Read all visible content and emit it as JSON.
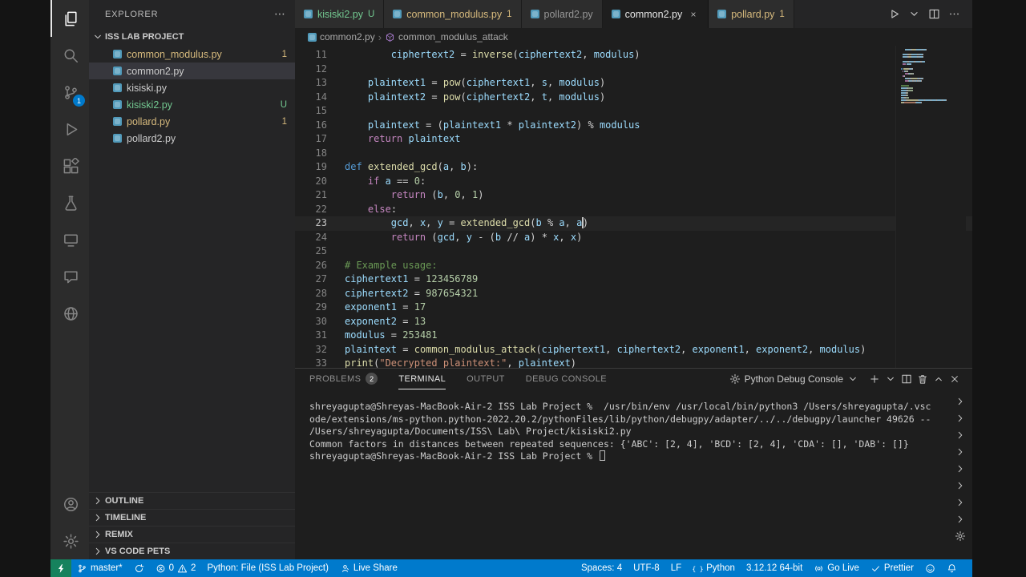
{
  "activity_bar": {
    "items": [
      {
        "name": "explorer",
        "icon": "files",
        "active": true
      },
      {
        "name": "search",
        "icon": "search"
      },
      {
        "name": "source-control",
        "icon": "scm",
        "badge": "1"
      },
      {
        "name": "run-debug",
        "icon": "debug"
      },
      {
        "name": "extensions",
        "icon": "extensions"
      },
      {
        "name": "testing",
        "icon": "flask"
      },
      {
        "name": "remote-explorer",
        "icon": "remote"
      },
      {
        "name": "comments",
        "icon": "comment"
      },
      {
        "name": "browser-preview",
        "icon": "globe"
      }
    ],
    "bottom": [
      {
        "name": "account",
        "icon": "account"
      },
      {
        "name": "settings",
        "icon": "gear"
      }
    ]
  },
  "sidebar": {
    "title": "EXPLORER",
    "more": "⋯",
    "section": "ISS LAB PROJECT",
    "files": [
      {
        "name": "common_modulus.py",
        "badge": "1",
        "color": "warning"
      },
      {
        "name": "common2.py",
        "selected": true
      },
      {
        "name": "kisiski.py"
      },
      {
        "name": "kisiski2.py",
        "badge": "U",
        "color": "added"
      },
      {
        "name": "pollard.py",
        "badge": "1",
        "color": "warning"
      },
      {
        "name": "pollard2.py"
      }
    ],
    "bottom_sections": [
      "OUTLINE",
      "TIMELINE",
      "REMIX",
      "VS CODE PETS"
    ]
  },
  "tabs": [
    {
      "label": "kisiski2.py",
      "badge": "U",
      "color": "added"
    },
    {
      "label": "common_modulus.py",
      "badge": "1",
      "color": "warning"
    },
    {
      "label": "pollard2.py"
    },
    {
      "label": "common2.py",
      "active": true
    },
    {
      "label": "pollard.py",
      "badge": "1",
      "color": "warning"
    }
  ],
  "editor_actions": [
    {
      "name": "run-python-file",
      "icon": "play"
    },
    {
      "name": "run-dropdown",
      "icon": "chevron-down"
    },
    {
      "name": "split-editor",
      "icon": "split"
    },
    {
      "name": "editor-more-actions",
      "icon": "ellipsis"
    }
  ],
  "breadcrumb": {
    "file": "common2.py",
    "symbol": "common_modulus_attack"
  },
  "editor": {
    "lines": [
      {
        "n": "11",
        "t": [
          [
            "        ",
            "p"
          ],
          [
            "ciphertext2",
            "v"
          ],
          [
            " = ",
            "p"
          ],
          [
            "inverse",
            "f"
          ],
          [
            "(",
            "p"
          ],
          [
            "ciphertext2",
            "v"
          ],
          [
            ", ",
            "p"
          ],
          [
            "modulus",
            "v"
          ],
          [
            ")",
            "p"
          ]
        ]
      },
      {
        "n": "12",
        "t": []
      },
      {
        "n": "13",
        "t": [
          [
            "    ",
            "p"
          ],
          [
            "plaintext1",
            "v"
          ],
          [
            " = ",
            "p"
          ],
          [
            "pow",
            "f"
          ],
          [
            "(",
            "p"
          ],
          [
            "ciphertext1",
            "v"
          ],
          [
            ", ",
            "p"
          ],
          [
            "s",
            "v"
          ],
          [
            ", ",
            "p"
          ],
          [
            "modulus",
            "v"
          ],
          [
            ")",
            "p"
          ]
        ]
      },
      {
        "n": "14",
        "t": [
          [
            "    ",
            "p"
          ],
          [
            "plaintext2",
            "v"
          ],
          [
            " = ",
            "p"
          ],
          [
            "pow",
            "f"
          ],
          [
            "(",
            "p"
          ],
          [
            "ciphertext2",
            "v"
          ],
          [
            ", ",
            "p"
          ],
          [
            "t",
            "v"
          ],
          [
            ", ",
            "p"
          ],
          [
            "modulus",
            "v"
          ],
          [
            ")",
            "p"
          ]
        ]
      },
      {
        "n": "15",
        "t": []
      },
      {
        "n": "16",
        "t": [
          [
            "    ",
            "p"
          ],
          [
            "plaintext",
            "v"
          ],
          [
            " = (",
            "p"
          ],
          [
            "plaintext1",
            "v"
          ],
          [
            " * ",
            "p"
          ],
          [
            "plaintext2",
            "v"
          ],
          [
            ") % ",
            "p"
          ],
          [
            "modulus",
            "v"
          ]
        ]
      },
      {
        "n": "17",
        "t": [
          [
            "    ",
            "p"
          ],
          [
            "return",
            "k"
          ],
          [
            " ",
            "p"
          ],
          [
            "plaintext",
            "v"
          ]
        ]
      },
      {
        "n": "18",
        "t": []
      },
      {
        "n": "19",
        "t": [
          [
            "def",
            "d"
          ],
          [
            " ",
            "p"
          ],
          [
            "extended_gcd",
            "f"
          ],
          [
            "(",
            "p"
          ],
          [
            "a",
            "v"
          ],
          [
            ", ",
            "p"
          ],
          [
            "b",
            "v"
          ],
          [
            "):",
            "p"
          ]
        ]
      },
      {
        "n": "20",
        "t": [
          [
            "    ",
            "p"
          ],
          [
            "if",
            "k"
          ],
          [
            " ",
            "p"
          ],
          [
            "a",
            "v"
          ],
          [
            " == ",
            "p"
          ],
          [
            "0",
            "n"
          ],
          [
            ":",
            "p"
          ]
        ]
      },
      {
        "n": "21",
        "t": [
          [
            "        ",
            "p"
          ],
          [
            "return",
            "k"
          ],
          [
            " (",
            "p"
          ],
          [
            "b",
            "v"
          ],
          [
            ", ",
            "p"
          ],
          [
            "0",
            "n"
          ],
          [
            ", ",
            "p"
          ],
          [
            "1",
            "n"
          ],
          [
            ")",
            "p"
          ]
        ]
      },
      {
        "n": "22",
        "t": [
          [
            "    ",
            "p"
          ],
          [
            "else",
            "k"
          ],
          [
            ":",
            "p"
          ]
        ]
      },
      {
        "n": "23",
        "cur": true,
        "t": [
          [
            "        ",
            "p"
          ],
          [
            "gcd",
            "v"
          ],
          [
            ", ",
            "p"
          ],
          [
            "x",
            "v"
          ],
          [
            ", ",
            "p"
          ],
          [
            "y",
            "v"
          ],
          [
            " = ",
            "p"
          ],
          [
            "extended_gcd",
            "f"
          ],
          [
            "(",
            "p"
          ],
          [
            "b",
            "v"
          ],
          [
            " % ",
            "p"
          ],
          [
            "a",
            "v"
          ],
          [
            ", ",
            "p"
          ],
          [
            "a",
            "v"
          ],
          [
            "",
            "caret"
          ],
          [
            ")",
            "p"
          ]
        ]
      },
      {
        "n": "24",
        "t": [
          [
            "        ",
            "p"
          ],
          [
            "return",
            "k"
          ],
          [
            " (",
            "p"
          ],
          [
            "gcd",
            "v"
          ],
          [
            ", ",
            "p"
          ],
          [
            "y",
            "v"
          ],
          [
            " - (",
            "p"
          ],
          [
            "b",
            "v"
          ],
          [
            " // ",
            "p"
          ],
          [
            "a",
            "v"
          ],
          [
            ") * ",
            "p"
          ],
          [
            "x",
            "v"
          ],
          [
            ", ",
            "p"
          ],
          [
            "x",
            "v"
          ],
          [
            ")",
            "p"
          ]
        ]
      },
      {
        "n": "25",
        "t": []
      },
      {
        "n": "26",
        "t": [
          [
            "# Example usage:",
            "c"
          ]
        ]
      },
      {
        "n": "27",
        "t": [
          [
            "ciphertext1",
            "v"
          ],
          [
            " = ",
            "p"
          ],
          [
            "123456789",
            "n"
          ]
        ]
      },
      {
        "n": "28",
        "t": [
          [
            "ciphertext2",
            "v"
          ],
          [
            " = ",
            "p"
          ],
          [
            "987654321",
            "n"
          ]
        ]
      },
      {
        "n": "29",
        "t": [
          [
            "exponent1",
            "v"
          ],
          [
            " = ",
            "p"
          ],
          [
            "17",
            "n"
          ]
        ]
      },
      {
        "n": "30",
        "t": [
          [
            "exponent2",
            "v"
          ],
          [
            " = ",
            "p"
          ],
          [
            "13",
            "n"
          ]
        ]
      },
      {
        "n": "31",
        "t": [
          [
            "modulus",
            "v"
          ],
          [
            " = ",
            "p"
          ],
          [
            "253481",
            "n"
          ]
        ]
      },
      {
        "n": "32",
        "t": [
          [
            "plaintext",
            "v"
          ],
          [
            " = ",
            "p"
          ],
          [
            "common_modulus_attack",
            "f"
          ],
          [
            "(",
            "p"
          ],
          [
            "ciphertext1",
            "v"
          ],
          [
            ", ",
            "p"
          ],
          [
            "ciphertext2",
            "v"
          ],
          [
            ", ",
            "p"
          ],
          [
            "exponent1",
            "v"
          ],
          [
            ", ",
            "p"
          ],
          [
            "exponent2",
            "v"
          ],
          [
            ", ",
            "p"
          ],
          [
            "modulus",
            "v"
          ],
          [
            ")",
            "p"
          ]
        ]
      },
      {
        "n": "33",
        "t": [
          [
            "print",
            "f"
          ],
          [
            "(",
            "p"
          ],
          [
            "\"Decrypted plaintext:\"",
            "s"
          ],
          [
            ", ",
            "p"
          ],
          [
            "plaintext",
            "v"
          ],
          [
            ")",
            "p"
          ]
        ]
      }
    ]
  },
  "panel": {
    "tabs": [
      {
        "label": "PROBLEMS",
        "badge": "2"
      },
      {
        "label": "TERMINAL",
        "active": true
      },
      {
        "label": "OUTPUT"
      },
      {
        "label": "DEBUG CONSOLE"
      }
    ],
    "console_selector": "Python Debug Console",
    "actions": [
      {
        "name": "new-terminal",
        "icon": "plus"
      },
      {
        "name": "terminal-profile-dropdown",
        "icon": "chevron-down"
      },
      {
        "name": "split-terminal",
        "icon": "split"
      },
      {
        "name": "kill-terminal",
        "icon": "trash"
      },
      {
        "name": "maximize-panel",
        "icon": "chevron-up"
      },
      {
        "name": "close-panel",
        "icon": "close"
      }
    ],
    "terminal_lines": [
      "shreyagupta@Shreyas-MacBook-Air-2 ISS Lab Project %  /usr/bin/env /usr/local/bin/python3 /Users/shreyagupta/.vsc",
      "ode/extensions/ms-python.python-2022.20.2/pythonFiles/lib/python/debugpy/adapter/../../debugpy/launcher 49626 --",
      "/Users/shreyagupta/Documents/ISS\\ Lab\\ Project/kisiski2.py",
      "Common factors in distances between repeated sequences: {'ABC': [2, 4], 'BCD': [2, 4], 'CDA': [], 'DAB': []}",
      "shreyagupta@Shreyas-MacBook-Air-2 ISS Lab Project % "
    ],
    "rail_instances": 8
  },
  "status_bar": {
    "remote": {
      "name": "remote-indicator",
      "icon": "zap",
      "bg": "#16825d"
    },
    "left": [
      {
        "name": "git-branch",
        "icon": "branch",
        "label": "master*"
      },
      {
        "name": "sync-changes",
        "icon": "sync",
        "label": ""
      },
      {
        "name": "problems-summary",
        "errors": "0",
        "warnings": "2"
      },
      {
        "name": "python-config",
        "label": "Python: File (ISS Lab Project)"
      },
      {
        "name": "live-share",
        "icon": "liveshare",
        "label": "Live Share"
      }
    ],
    "right": [
      {
        "name": "indentation",
        "label": "Spaces: 4"
      },
      {
        "name": "encoding",
        "label": "UTF-8"
      },
      {
        "name": "eol",
        "label": "LF"
      },
      {
        "name": "language-mode",
        "icon": "braces",
        "label": "Python"
      },
      {
        "name": "python-interpreter",
        "label": "3.12.12 64-bit"
      },
      {
        "name": "go-live",
        "icon": "broadcast",
        "label": "Go Live"
      },
      {
        "name": "prettier",
        "icon": "check",
        "label": "Prettier"
      },
      {
        "name": "feedback",
        "icon": "feedback",
        "label": ""
      },
      {
        "name": "notifications",
        "icon": "bell",
        "label": ""
      }
    ]
  }
}
